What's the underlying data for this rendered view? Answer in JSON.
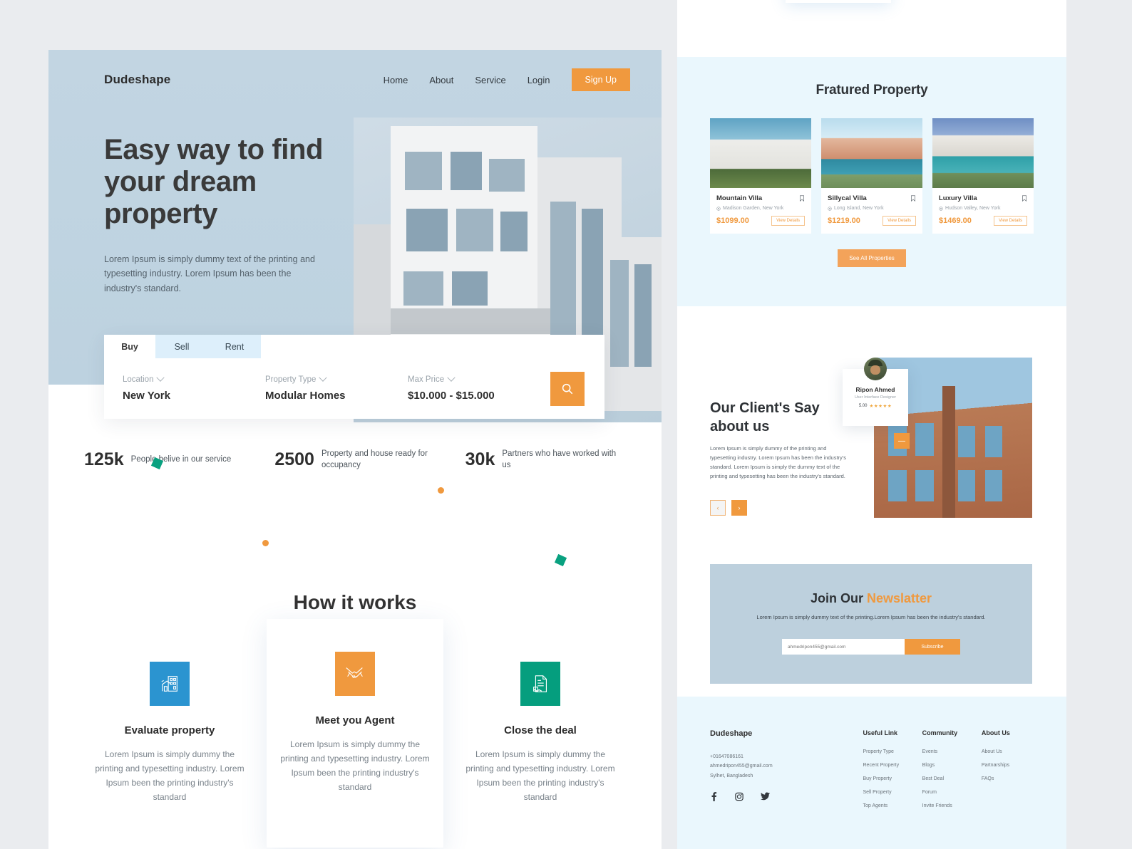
{
  "left": {
    "logo": "Dudeshape",
    "nav": [
      {
        "label": "Home"
      },
      {
        "label": "About"
      },
      {
        "label": "Service"
      },
      {
        "label": "Login"
      }
    ],
    "signup_label": "Sign Up",
    "hero": {
      "title": "Easy way to find your dream property",
      "subtitle": "Lorem Ipsum is simply dummy text of the printing and typesetting industry. Lorem Ipsum has been the industry's standard."
    },
    "search": {
      "tabs": [
        {
          "label": "Buy",
          "active": true
        },
        {
          "label": "Sell",
          "active": false
        },
        {
          "label": "Rent",
          "active": false
        }
      ],
      "filters": [
        {
          "label": "Location",
          "value": "New York"
        },
        {
          "label": "Property Type",
          "value": "Modular Homes"
        },
        {
          "label": "Max Price",
          "value": "$10.000 - $15.000"
        }
      ],
      "search_icon": "search-icon"
    },
    "stats": [
      {
        "number": "125k",
        "text": "People belive in our service"
      },
      {
        "number": "2500",
        "text": "Property and house ready for occupancy"
      },
      {
        "number": "30k",
        "text": "Partners who have worked with us"
      }
    ],
    "how_it_works": {
      "title": "How it works",
      "cards": [
        {
          "icon": "building-appraisal-icon",
          "icon_color": "#2b94d0",
          "name": "Evaluate property",
          "desc": "Lorem Ipsum is simply dummy the printing and typesetting industry. Lorem Ipsum been the printing industry's standard",
          "raised": false
        },
        {
          "icon": "handshake-icon",
          "icon_color": "#f0993e",
          "name": "Meet you Agent",
          "desc": "Lorem Ipsum is simply dummy the printing and typesetting industry. Lorem Ipsum been the printing industry's standard",
          "raised": true
        },
        {
          "icon": "contract-signing-icon",
          "icon_color": "#059e7e",
          "name": "Close the deal",
          "desc": "Lorem Ipsum is simply dummy the printing and typesetting industry. Lorem Ipsum been the printing industry's standard",
          "raised": false
        }
      ]
    }
  },
  "right": {
    "featured": {
      "title": "Fratured Property",
      "see_all_label": "See All Properties",
      "properties": [
        {
          "name": "Mountain Villa",
          "location": "Madison Garden, New York",
          "price": "$1099.00",
          "view_label": "View Details",
          "bookmark_icon": "bookmark-icon",
          "pin_icon": "location-pin-icon"
        },
        {
          "name": "Sillycal Villa",
          "location": "Long Island, New York",
          "price": "$1219.00",
          "view_label": "View Details",
          "bookmark_icon": "bookmark-icon",
          "pin_icon": "location-pin-icon"
        },
        {
          "name": "Luxury Villa",
          "location": "Hudson Valley, New York",
          "price": "$1469.00",
          "view_label": "View Details",
          "bookmark_icon": "bookmark-icon",
          "pin_icon": "location-pin-icon"
        }
      ]
    },
    "testimonial": {
      "title": "Our Client's Say about us",
      "body": "Lorem Ipsum is simply dummy of the printing and typesetting industry. Lorem Ipsum has been the industry's standard. Lorem Ipsum is simply the dummy text of the printing and typesetting has been the industry's standard.",
      "person_name": "Ripon Ahmed",
      "person_role": "User Interface Designer",
      "rating": "5.00",
      "stars": "★★★★★",
      "prev_icon": "chevron-left-icon",
      "next_icon": "chevron-right-icon",
      "quote_icon": "quote-icon"
    },
    "newsletter": {
      "title_main": "Join Our ",
      "title_highlight": "Newslatter",
      "subtitle": "Lorem Ipsum is simply dummy text of the printing.Lorem Ipsum has been the industry's standard.",
      "email_placeholder": "ahmedripon455@gmail.com",
      "subscribe_label": "Subscribe"
    },
    "footer": {
      "logo": "Dudeshape",
      "phone": "+01647086161",
      "email": "ahmedripon455@gmail.com",
      "address": "Sylhet, Bangladesh",
      "social": [
        {
          "name": "facebook-icon",
          "glyph": "f"
        },
        {
          "name": "instagram-icon",
          "glyph": "▢"
        },
        {
          "name": "twitter-icon",
          "glyph": "✐"
        }
      ],
      "columns": [
        {
          "title": "Useful Link",
          "links": [
            "Property Type",
            "Recent Property",
            "Buy Property",
            "Sell Property",
            "Top Agents"
          ]
        },
        {
          "title": "Community",
          "links": [
            "Events",
            "Blogs",
            "Best Deal",
            "Forum",
            "Invite Friends"
          ]
        },
        {
          "title": "About Us",
          "links": [
            "About Us",
            "Partnarships",
            "FAQs"
          ]
        }
      ]
    }
  },
  "colors": {
    "accent_orange": "#f0993e",
    "hero_blue": "#bdd2e0",
    "panel_light_blue": "#eaf7fd",
    "teal": "#09a180",
    "blue_icon": "#2b94d0",
    "canvas_gray": "#eaecef"
  }
}
